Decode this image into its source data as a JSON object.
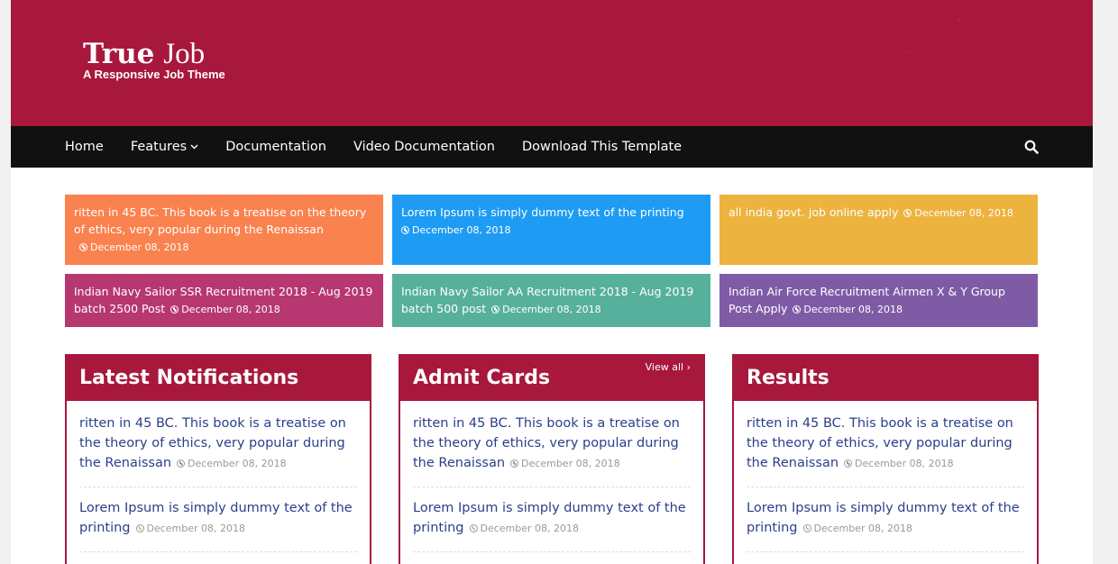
{
  "site": {
    "title_bold": "True",
    "title_light": "Job",
    "tagline": "A Responsive Job Theme"
  },
  "nav": {
    "items": [
      {
        "label": "Home"
      },
      {
        "label": "Features"
      },
      {
        "label": "Documentation"
      },
      {
        "label": "Video Documentation"
      },
      {
        "label": "Download This Template"
      }
    ],
    "features_chevron": "›"
  },
  "colors": {
    "brand": "#a8173c",
    "nav_bg": "#111111",
    "tile_orange": "#f9824f",
    "tile_blue": "#1e9bf3",
    "tile_yellow": "#ecb33f",
    "tile_pink": "#b73770",
    "tile_teal": "#57b09b",
    "tile_purple": "#7f5ba6"
  },
  "tiles": [
    {
      "text": "ritten in 45 BC. This book is a treatise on the theory of ethics, very popular during the Renaissan",
      "date": "December 08, 2018"
    },
    {
      "text": "Lorem Ipsum is simply dummy text of the printing",
      "date": "December 08, 2018"
    },
    {
      "text": "all india govt. job online apply",
      "date": "December 08, 2018"
    },
    {
      "text": "Indian Navy Sailor SSR Recruitment 2018 - Aug 2019 batch 2500 Post",
      "date": "December 08, 2018"
    },
    {
      "text": "Indian Navy Sailor AA Recruitment 2018 - Aug 2019 batch 500 post",
      "date": "December 08, 2018"
    },
    {
      "text": "Indian Air Force Recruitment Airmen X & Y Group Post Apply",
      "date": "December 08, 2018"
    }
  ],
  "panels": [
    {
      "title": "Latest Notifications",
      "posts": [
        {
          "text": "ritten in 45 BC. This book is a treatise on the theory of ethics, very popular during the Renaissan",
          "date": "December 08, 2018"
        },
        {
          "text": "Lorem Ipsum is simply dummy text of the printing",
          "date": "December 08, 2018"
        }
      ]
    },
    {
      "title": "Admit Cards",
      "view_all": "View all ›",
      "posts": [
        {
          "text": "ritten in 45 BC. This book is a treatise on the theory of ethics, very popular during the Renaissan",
          "date": "December 08, 2018"
        },
        {
          "text": "Lorem Ipsum is simply dummy text of the printing",
          "date": "December 08, 2018"
        }
      ]
    },
    {
      "title": "Results",
      "posts": [
        {
          "text": "ritten in 45 BC. This book is a treatise on the theory of ethics, very popular during the Renaissan",
          "date": "December 08, 2018"
        },
        {
          "text": "Lorem Ipsum is simply dummy text of the printing",
          "date": "December 08, 2018"
        }
      ]
    }
  ],
  "icons": [
    "search-icon",
    "clock-icon",
    "chevron-down-icon",
    "chevron-right-icon"
  ]
}
